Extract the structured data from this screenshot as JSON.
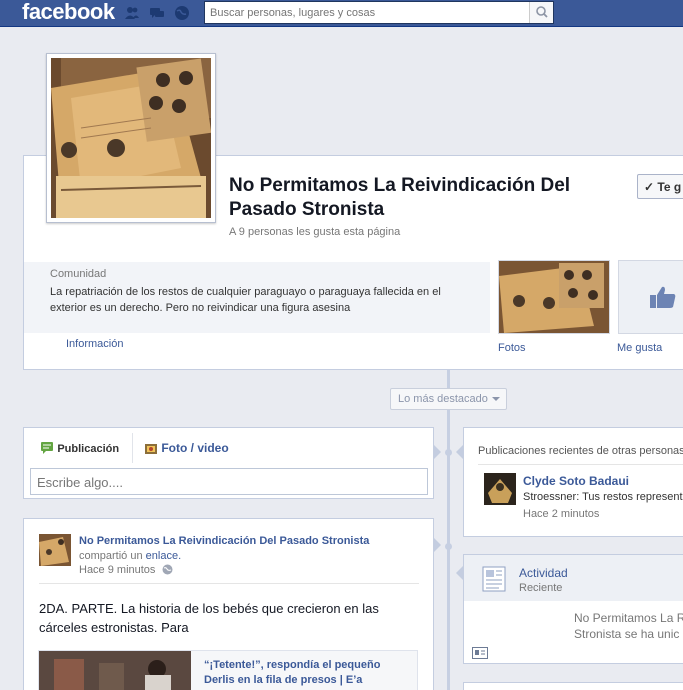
{
  "topbar": {
    "logo": "facebook",
    "search_placeholder": "Buscar personas, lugares y cosas"
  },
  "page": {
    "name": "No Permitamos La Reivindicación Del Pasado Stronista",
    "likes_line": "A 9 personas les gusta esta página",
    "like_button": "✓ Te g"
  },
  "about": {
    "category": "Comunidad",
    "description": "La repatriación de los restos de cualquier paraguayo o paraguaya fallecida en el exterior es un derecho. Pero no reivindicar una figura asesina",
    "info_link": "Información"
  },
  "tiles": {
    "photos": "Fotos",
    "likes": "Me gusta"
  },
  "filter": {
    "label": "Lo más destacado"
  },
  "composer": {
    "tab_post": "Publicación",
    "tab_photo": "Foto / video",
    "placeholder": "Escribe algo...."
  },
  "post": {
    "author": "No Permitamos La Reivindicación Del Pasado Stronista",
    "action_prefix": "compartió un ",
    "action_link": "enlace.",
    "action_suffix": "",
    "time": "Hace 9 minutos",
    "text": "2DA. PARTE. La historia de los bebés que crecieron en las cárceles estronistas. Para",
    "link_title": "“¡Tetente!”, respondía el pequeño Derlis en la fila de presos | E’a"
  },
  "recent": {
    "heading": "Publicaciones recientes de otras personas",
    "name": "Clyde Soto Badaui",
    "snippet": "Stroessner: Tus restos representa",
    "time": "Hace 2 minutos"
  },
  "activity": {
    "title": "Actividad",
    "subtitle": "Reciente",
    "text_line1": "No Permitamos La R",
    "text_line2": "Stronista se ha unic"
  },
  "colors": {
    "brand": "#3b5998",
    "background": "#e9ebf1"
  }
}
